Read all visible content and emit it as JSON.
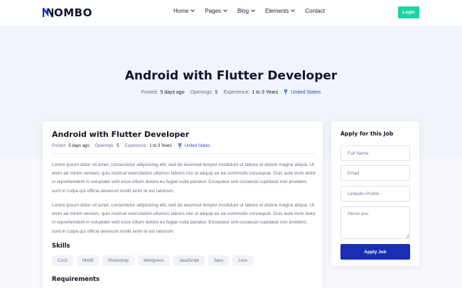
{
  "brand": {
    "name": "OMBO",
    "mark": "N"
  },
  "nav": {
    "items": [
      {
        "label": "Home",
        "has_dropdown": true
      },
      {
        "label": "Pages",
        "has_dropdown": true
      },
      {
        "label": "Blog",
        "has_dropdown": true
      },
      {
        "label": "Elements",
        "has_dropdown": true
      },
      {
        "label": "Contact",
        "has_dropdown": false
      }
    ],
    "login_label": "Login"
  },
  "hero": {
    "title": "Android with Flutter Developer",
    "posted_label": "Posted:",
    "posted_value": "5 days ago",
    "openings_label": "Openings:",
    "openings_value": "5",
    "experience_label": "Experience:",
    "experience_value": "1 to 3 Years",
    "location": "United States"
  },
  "job": {
    "title": "Android with Flutter Developer",
    "posted_label": "Posted:",
    "posted_value": "5 days ago",
    "openings_label": "Openings:",
    "openings_value": "5",
    "experience_label": "Experience:",
    "experience_value": "1 to 3 Years",
    "location": "United States",
    "paragraphs": [
      "Lorem ipsum dolor sit amet, consectetur adipisicing elit, sed do eiusmod tempor incididunt ut labore et dolore magna aliqua. Ut enim ad minim veniam, quis nostrud exercitation ullamco laboris nisi ut aliquip ex ea commodo consequat. Duis aute irure dolor in reprehenderit in voluptate velit esse cillum dolore eu fugiat nulla pariatur. Excepteur sint occaecat cupidatat non proident, sunt in culpa qui officia deserunt mollit anim id est laborum.",
      "Lorem ipsum dolor sit amet, consectetur adipisicing elit, sed do eiusmod tempor incididunt ut labore et dolore magna aliqua. Ut enim ad minim veniam, quis nostrud exercitation ullamco laboris nisi ut aliquip ex ea commodo consequat. Duis aute irure dolor in reprehenderit in voluptate velit esse cillum dolore eu fugiat nulla pariatur. Excepteur sint occaecat cupidatat non proident, sunt in culpa qui officia deserunt mollit anim id est laborum."
    ],
    "skills_title": "Skills",
    "skills": [
      "Css3",
      "Html5",
      "Photoshop",
      "Wordpress",
      "JavaScript",
      "Sass",
      "Less"
    ],
    "requirements_title": "Requirements"
  },
  "apply": {
    "title": "Apply for this Job",
    "full_name_placeholder": "Full Name",
    "email_placeholder": "Email",
    "linkedin_placeholder": "Linkedin Profile",
    "about_placeholder": "About you",
    "button_label": "Apply Job"
  },
  "colors": {
    "accent": "#1a2db4",
    "login": "#1dd3a2",
    "link": "#2b49c7",
    "hero_bg": "#f1f4fb"
  }
}
